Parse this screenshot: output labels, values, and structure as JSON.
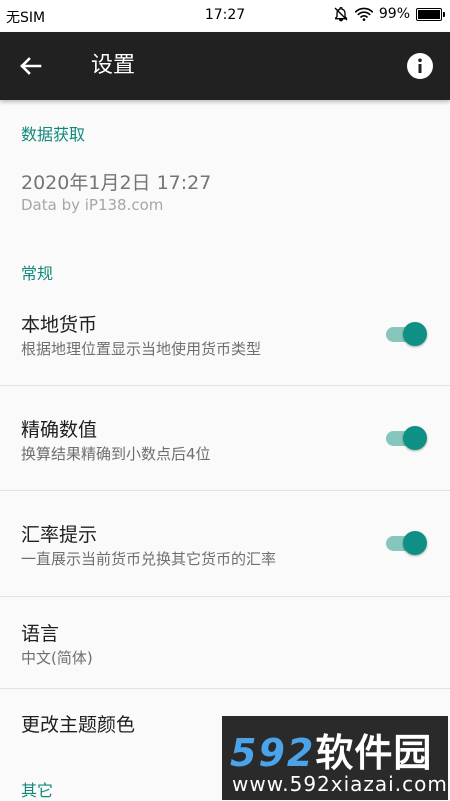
{
  "statusbar": {
    "carrier": "无SIM",
    "time": "17:27",
    "battery": "99%",
    "icons": [
      "bell-off-icon",
      "wifi-icon",
      "battery-icon"
    ],
    "battery_level": 0.99
  },
  "appbar": {
    "title": "设置",
    "back_icon": "arrow-left-icon",
    "info_icon": "info-icon"
  },
  "sections": {
    "data": {
      "header": "数据获取",
      "date": "2020年1月2日 17:27",
      "source": "Data by iP138.com"
    },
    "general": {
      "header": "常规",
      "local_currency": {
        "title": "本地货币",
        "subtitle": "根据地理位置显示当地使用货币类型",
        "enabled": true
      },
      "precision": {
        "title": "精确数值",
        "subtitle": "换算结果精确到小数点后4位",
        "enabled": true
      },
      "rate_hint": {
        "title": "汇率提示",
        "subtitle": "一直展示当前货币兑换其它货币的汇率",
        "enabled": true
      },
      "language": {
        "title": "语言",
        "value": "中文(简体)"
      },
      "theme": {
        "title": "更改主题颜色"
      }
    },
    "other": {
      "header": "其它"
    }
  },
  "watermark": {
    "brand_num": "592",
    "brand_cn": "软件园",
    "url": "www.592xiazai.com"
  },
  "colors": {
    "accent": "#12897a",
    "switch_thumb": "#0e9184",
    "switch_track": "#87c6bd",
    "appbar": "#212121"
  }
}
